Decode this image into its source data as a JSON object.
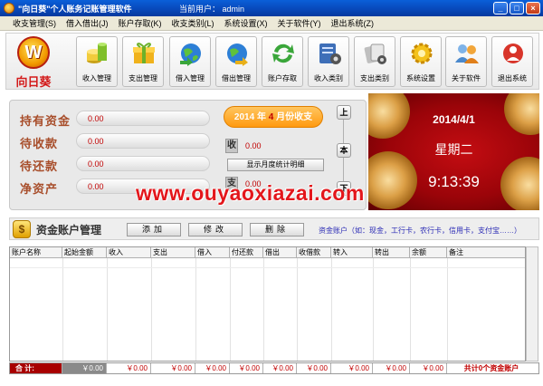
{
  "window": {
    "title": "\"向日葵\"个人账务记账管理软件",
    "user_label": "当前用户：",
    "user": "admin",
    "buttons": [
      "_",
      "□",
      "×"
    ]
  },
  "menu": [
    "收支管理(S)",
    "借入借出(J)",
    "账户存取(K)",
    "收支类别(L)",
    "系统设置(X)",
    "关于软件(Y)",
    "退出系统(Z)"
  ],
  "logo": {
    "letter": "W",
    "name": "向日葵"
  },
  "toolbar": [
    {
      "label": "收入管理",
      "icon": "coins-stack-icon"
    },
    {
      "label": "支出管理",
      "icon": "gift-box-icon"
    },
    {
      "label": "借入管理",
      "icon": "globe-arrow-in-icon"
    },
    {
      "label": "借出管理",
      "icon": "globe-arrow-out-icon"
    },
    {
      "label": "账户存取",
      "icon": "refresh-arrows-icon"
    },
    {
      "label": "收入类别",
      "icon": "category-settings-icon"
    },
    {
      "label": "支出类别",
      "icon": "cards-icon"
    },
    {
      "label": "系统设置",
      "icon": "gear-icon"
    },
    {
      "label": "关于软件",
      "icon": "users-icon"
    },
    {
      "label": "退出系统",
      "icon": "exit-icon"
    }
  ],
  "summary": {
    "holding": {
      "label": "持有资金",
      "value": "0.00"
    },
    "receivable": {
      "label": "待收款",
      "value": "0.00"
    },
    "payable": {
      "label": "待还款",
      "value": "0.00"
    },
    "net": {
      "label": "净资产",
      "value": "0.00"
    }
  },
  "monthly": {
    "year": "2014",
    "year_suffix": "年",
    "month": "4",
    "month_suffix": "月份收支",
    "income_tag": "收",
    "income": "0.00",
    "expense_tag": "支",
    "expense": "0.00",
    "detail_button": "显示月度统计明细",
    "nav_prev": "上",
    "nav_current": "本",
    "nav_next": "下"
  },
  "datepanel": {
    "date": "2014/4/1",
    "weekday": "星期二",
    "time": "9:13:39"
  },
  "watermark": "www.ouyaoxiazai.com",
  "accounts": {
    "title": "资金账户管理",
    "add": "添加",
    "edit": "修改",
    "delete": "删除",
    "hint": "资金账户（如：现金，工行卡，农行卡，信用卡，支付宝……）"
  },
  "table": {
    "columns": [
      "账户名称",
      "起始金额",
      "收入",
      "支出",
      "借入",
      "付还款",
      "借出",
      "收借款",
      "转入",
      "转出",
      "余额",
      "备注"
    ]
  },
  "totals": {
    "label": "合  计:",
    "values": [
      "￥0.00",
      "￥0.00",
      "￥0.00",
      "￥0.00",
      "￥0.00",
      "￥0.00",
      "￥0.00",
      "￥0.00",
      "￥0.00",
      "￥0.00"
    ],
    "count_prefix": "共计",
    "count": "0",
    "count_suffix": "个资金账户"
  },
  "colors": {
    "accent": "#ff9a10",
    "brand": "#d31a1a",
    "titlebar": "#0847b8",
    "datepanel": "#9b0409"
  }
}
